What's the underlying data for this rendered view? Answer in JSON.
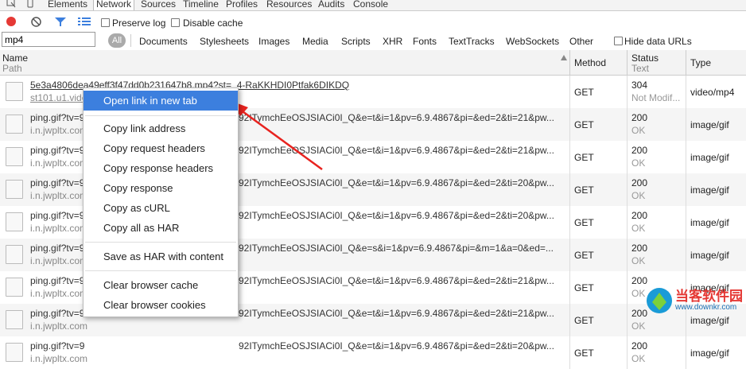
{
  "devtools": {
    "tabs": [
      "Elements",
      "Network",
      "Sources",
      "Timeline",
      "Profiles",
      "Resources",
      "Audits",
      "Console"
    ],
    "active_tab": "Network"
  },
  "toolbar": {
    "preserve_log": "Preserve log",
    "disable_cache": "Disable cache",
    "record_color": "#e53935"
  },
  "filter": {
    "value": "mp4",
    "all": "All",
    "types": [
      "Documents",
      "Stylesheets",
      "Images",
      "Media",
      "Scripts",
      "XHR",
      "Fonts",
      "TextTracks",
      "WebSockets",
      "Other"
    ],
    "hide_data_urls": "Hide data URLs"
  },
  "columns": {
    "name": "Name",
    "path": "Path",
    "method": "Method",
    "status": "Status",
    "text": "Text",
    "type": "Type"
  },
  "rows": [
    {
      "name": "5e3a4806dea49eff3f47dd0b231647b8.mp4?st=_4-RaKKHDI0Ptfak6DIKDQ",
      "path": "st101.u1.vide",
      "tail": "",
      "method": "GET",
      "status": "304",
      "status_text": "Not Modif...",
      "type": "video/mp4"
    },
    {
      "name": "ping.gif?tv=9",
      "path": "i.n.jwpltx.com",
      "tail": "92ITymchEeOSJSIACi0I_Q&e=t&i=1&pv=6.9.4867&pi=&ed=2&ti=21&pw...",
      "method": "GET",
      "status": "200",
      "status_text": "OK",
      "type": "image/gif"
    },
    {
      "name": "ping.gif?tv=9",
      "path": "i.n.jwpltx.com",
      "tail": "92ITymchEeOSJSIACi0I_Q&e=t&i=1&pv=6.9.4867&pi=&ed=2&ti=21&pw...",
      "method": "GET",
      "status": "200",
      "status_text": "OK",
      "type": "image/gif"
    },
    {
      "name": "ping.gif?tv=9",
      "path": "i.n.jwpltx.com",
      "tail": "92ITymchEeOSJSIACi0I_Q&e=t&i=1&pv=6.9.4867&pi=&ed=2&ti=20&pw...",
      "method": "GET",
      "status": "200",
      "status_text": "OK",
      "type": "image/gif"
    },
    {
      "name": "ping.gif?tv=9",
      "path": "i.n.jwpltx.com",
      "tail": "92ITymchEeOSJSIACi0I_Q&e=t&i=1&pv=6.9.4867&pi=&ed=2&ti=20&pw...",
      "method": "GET",
      "status": "200",
      "status_text": "OK",
      "type": "image/gif"
    },
    {
      "name": "ping.gif?tv=9",
      "path": "i.n.jwpltx.com",
      "tail": "92ITymchEeOSJSIACi0I_Q&e=s&i=1&pv=6.9.4867&pi=&m=1&a=0&ed=...",
      "method": "GET",
      "status": "200",
      "status_text": "OK",
      "type": "image/gif"
    },
    {
      "name": "ping.gif?tv=9",
      "path": "i.n.jwpltx.com",
      "tail": "92ITymchEeOSJSIACi0I_Q&e=t&i=1&pv=6.9.4867&pi=&ed=2&ti=21&pw...",
      "method": "GET",
      "status": "200",
      "status_text": "OK",
      "type": "image/gif"
    },
    {
      "name": "ping.gif?tv=9",
      "path": "i.n.jwpltx.com",
      "tail": "92ITymchEeOSJSIACi0I_Q&e=t&i=1&pv=6.9.4867&pi=&ed=2&ti=21&pw...",
      "method": "GET",
      "status": "200",
      "status_text": "OK",
      "type": "image/gif"
    },
    {
      "name": "ping.gif?tv=9",
      "path": "i.n.jwpltx.com",
      "tail": "92ITymchEeOSJSIACi0I_Q&e=t&i=1&pv=6.9.4867&pi=&ed=2&ti=20&pw...",
      "method": "GET",
      "status": "200",
      "status_text": "OK",
      "type": "image/gif"
    }
  ],
  "context_menu": {
    "items": [
      "Open link in new tab",
      "Copy link address",
      "Copy request headers",
      "Copy response headers",
      "Copy response",
      "Copy as cURL",
      "Copy all as HAR",
      "Save as HAR with content",
      "Clear browser cache",
      "Clear browser cookies"
    ],
    "highlight_color": "#3c7fde"
  },
  "annotation": {
    "arrow_color": "#e8231f"
  },
  "watermark": {
    "line1": "当客软件园",
    "line2": "www.downkr.com"
  }
}
